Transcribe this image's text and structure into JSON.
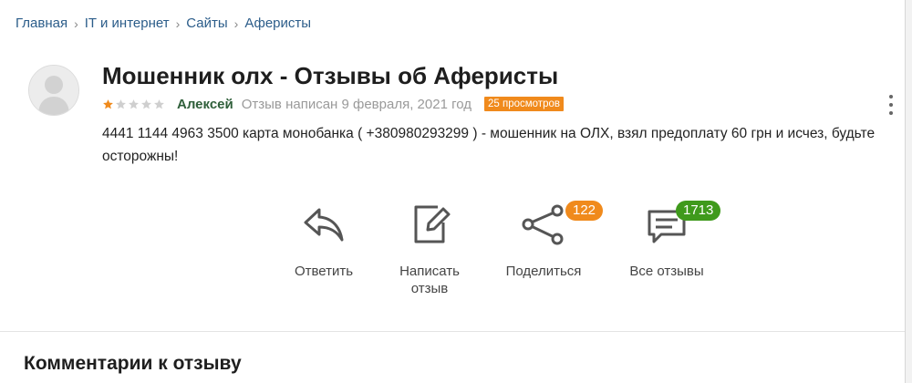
{
  "breadcrumb": {
    "items": [
      "Главная",
      "IT и интернет",
      "Сайты",
      "Аферисты"
    ],
    "separator": "›"
  },
  "review": {
    "title": "Мошенник олх - Отзывы об Аферисты",
    "rating": 1,
    "rating_max": 5,
    "author": "Алексей",
    "written": "Отзыв написан 9 февраля, 2021 год",
    "views": "25 просмотров",
    "text": "4441 1144 4963 3500 карта монобанка ( +380980293299 ) - мошенник на ОЛХ, взял предоплату 60 грн и исчез, будьте осторожны!"
  },
  "actions": {
    "reply": {
      "label": "Ответить",
      "icon": "reply-arrow-icon"
    },
    "write": {
      "label": "Написать отзыв",
      "icon": "edit-pencil-icon"
    },
    "share": {
      "label": "Поделиться",
      "icon": "share-icon",
      "count": "122"
    },
    "all": {
      "label": "Все отзывы",
      "icon": "comments-icon",
      "count": "1713"
    }
  },
  "comments": {
    "title": "Комментарии к отзыву"
  },
  "colors": {
    "link": "#2c5d8a",
    "author": "#2f5f3a",
    "badge_orange": "#f08a1c",
    "badge_green": "#3f9a1c",
    "star_filled": "#f08a1c",
    "star_empty": "#cfcfcf"
  }
}
